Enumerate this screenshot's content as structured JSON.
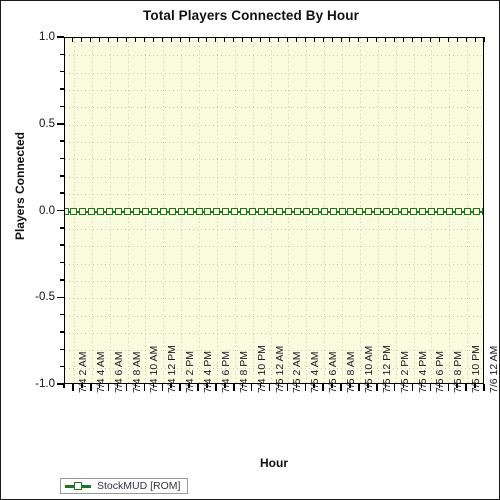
{
  "chart_data": {
    "type": "line",
    "title": "Total Players Connected By Hour",
    "xlabel": "Hour",
    "ylabel": "Players Connected",
    "ylim": [
      -1.0,
      1.0
    ],
    "ytick_labels": [
      "1.0",
      "0.5",
      "0.0",
      "-0.5",
      "-1.0"
    ],
    "ytick_values": [
      1.0,
      0.5,
      0.0,
      -0.5,
      -1.0
    ],
    "y_minor_ticks_per_major": 5,
    "grid": true,
    "grid_style": "dotted",
    "legend_position": "bottom-left",
    "plot_background": "#fbfbe0",
    "categories": [
      "7/4 1 AM",
      "7/4 2 AM",
      "7/4 3 AM",
      "7/4 4 AM",
      "7/4 5 AM",
      "7/4 6 AM",
      "7/4 7 AM",
      "7/4 8 AM",
      "7/4 9 AM",
      "7/4 10 AM",
      "7/4 11 AM",
      "7/4 12 PM",
      "7/4 1 PM",
      "7/4 2 PM",
      "7/4 3 PM",
      "7/4 4 PM",
      "7/4 5 PM",
      "7/4 6 PM",
      "7/4 7 PM",
      "7/4 8 PM",
      "7/4 9 PM",
      "7/4 10 PM",
      "7/4 11 PM",
      "7/5 12 AM",
      "7/5 1 AM",
      "7/5 2 AM",
      "7/5 3 AM",
      "7/5 4 AM",
      "7/5 5 AM",
      "7/5 6 AM",
      "7/5 7 AM",
      "7/5 8 AM",
      "7/5 9 AM",
      "7/5 10 AM",
      "7/5 11 AM",
      "7/5 12 PM",
      "7/5 1 PM",
      "7/5 2 PM",
      "7/5 3 PM",
      "7/5 4 PM",
      "7/5 5 PM",
      "7/5 6 PM",
      "7/5 7 PM",
      "7/5 8 PM",
      "7/5 9 PM",
      "7/5 10 PM",
      "7/5 11 PM",
      "7/6 12 AM"
    ],
    "xtick_labels": [
      "7/4 2 AM",
      "7/4 4 AM",
      "7/4 6 AM",
      "7/4 8 AM",
      "7/4 10 AM",
      "7/4 12 PM",
      "7/4 2 PM",
      "7/4 4 PM",
      "7/4 6 PM",
      "7/4 8 PM",
      "7/4 10 PM",
      "7/5 12 AM",
      "7/5 2 AM",
      "7/5 4 AM",
      "7/5 6 AM",
      "7/5 8 AM",
      "7/5 10 AM",
      "7/5 12 PM",
      "7/5 2 PM",
      "7/5 4 PM",
      "7/5 6 PM",
      "7/5 8 PM",
      "7/5 10 PM",
      "7/6 12 AM"
    ],
    "series": [
      {
        "name": "StockMUD [ROM]",
        "color": "#1a7a1a",
        "marker": "square-hollow",
        "values": [
          0,
          0,
          0,
          0,
          0,
          0,
          0,
          0,
          0,
          0,
          0,
          0,
          0,
          0,
          0,
          0,
          0,
          0,
          0,
          0,
          0,
          0,
          0,
          0,
          0,
          0,
          0,
          0,
          0,
          0,
          0,
          0,
          0,
          0,
          0,
          0,
          0,
          0,
          0,
          0,
          0,
          0,
          0,
          0,
          0,
          0,
          0,
          0
        ]
      }
    ]
  },
  "legend": {
    "entries": [
      {
        "label": "StockMUD [ROM]",
        "color": "#1a7a1a"
      }
    ]
  }
}
